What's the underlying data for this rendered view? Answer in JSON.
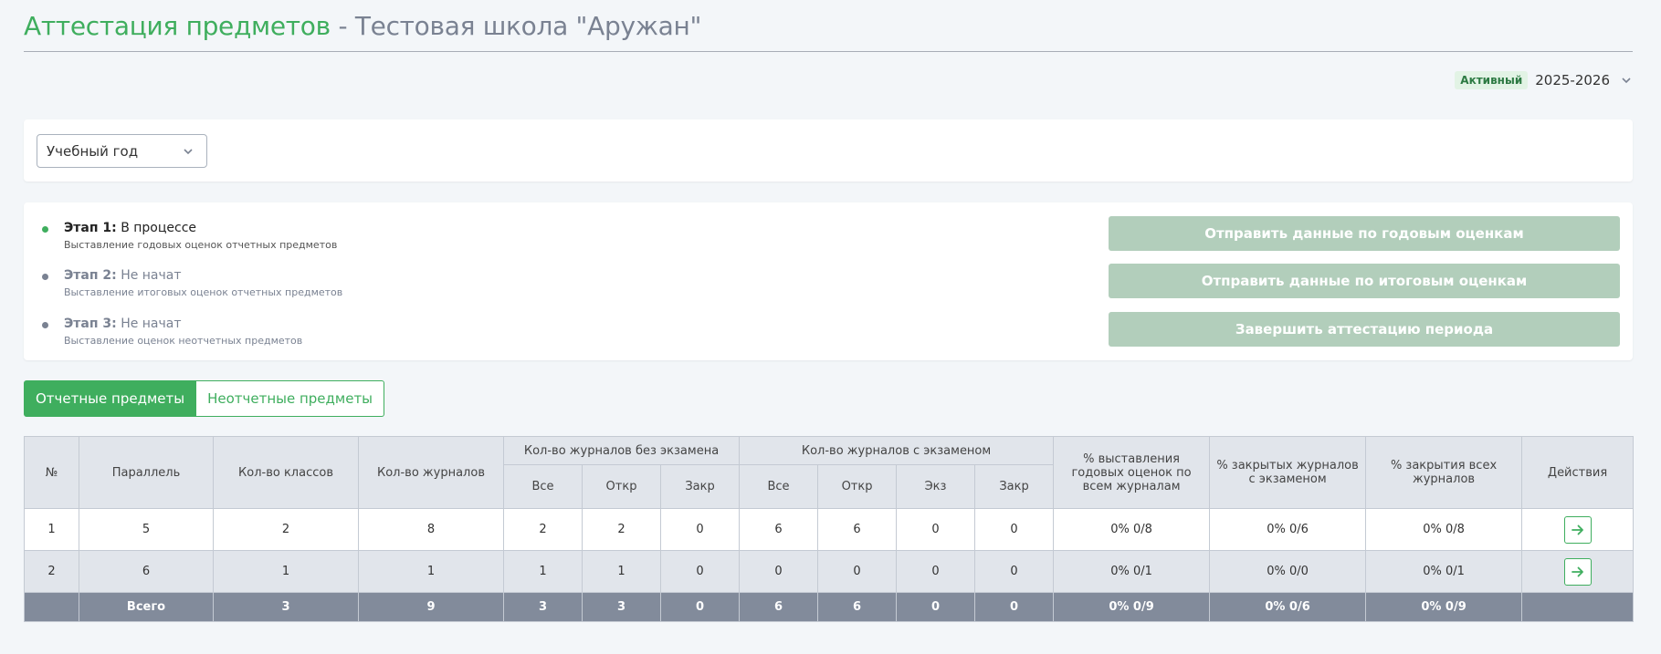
{
  "header": {
    "title_main": "Аттестация предметов",
    "title_sub": "- Тестовая школа \"Аружан\""
  },
  "year_picker": {
    "status_badge": "Активный",
    "value": "2025-2026",
    "icon": "chevron-down-icon"
  },
  "filter": {
    "year_select_value": "Учебный год",
    "icon": "chevron-down-icon"
  },
  "stages": [
    {
      "label": "Этап 1:",
      "status": "В процессе",
      "description": "Выставление годовых оценок отчетных предметов",
      "active": true,
      "dot_color": "#3fae5e"
    },
    {
      "label": "Этап 2:",
      "status": "Не начат",
      "description": "Выставление итоговых оценок отчетных предметов",
      "active": false,
      "dot_color": "#7a8292"
    },
    {
      "label": "Этап 3:",
      "status": "Не начат",
      "description": "Выставление оценок неотчетных предметов",
      "active": false,
      "dot_color": "#7a8292"
    }
  ],
  "actions": [
    {
      "label": "Отправить данные по годовым оценкам"
    },
    {
      "label": "Отправить данные по итоговым оценкам"
    },
    {
      "label": "Завершить аттестацию периода"
    }
  ],
  "tabs": [
    {
      "label": "Отчетные предметы",
      "active": true
    },
    {
      "label": "Неотчетные предметы",
      "active": false
    }
  ],
  "table": {
    "headers": {
      "num": "№",
      "parallel": "Параллель",
      "classes": "Кол-во классов",
      "journals": "Кол-во журналов",
      "no_exam_group": "Кол-во журналов без экзамена",
      "exam_group": "Кол-во журналов с экзаменом",
      "pct_annual": "% выставления годовых оценок по всем журналам",
      "pct_closed_exam": "% закрытых журналов с экзаменом",
      "pct_closed_all": "% закрытия всех журналов",
      "actions": "Действия",
      "no_exam_sub": [
        "Все",
        "Откр",
        "Закр"
      ],
      "exam_sub": [
        "Все",
        "Откр",
        "Экз",
        "Закр"
      ]
    },
    "rows": [
      {
        "num": "1",
        "parallel": "5",
        "classes": "2",
        "journals": "8",
        "ne_all": "2",
        "ne_open": "2",
        "ne_closed": "0",
        "e_all": "6",
        "e_open": "6",
        "e_exam": "0",
        "e_closed": "0",
        "pct_annual": "0% 0/8",
        "pct_closed_exam": "0% 0/6",
        "pct_closed_all": "0% 0/8",
        "action_icon": "arrow-right-icon"
      },
      {
        "num": "2",
        "parallel": "6",
        "classes": "1",
        "journals": "1",
        "ne_all": "1",
        "ne_open": "1",
        "ne_closed": "0",
        "e_all": "0",
        "e_open": "0",
        "e_exam": "0",
        "e_closed": "0",
        "pct_annual": "0% 0/1",
        "pct_closed_exam": "0% 0/0",
        "pct_closed_all": "0% 0/1",
        "action_icon": "arrow-right-icon"
      }
    ],
    "total": {
      "label": "Всего",
      "classes": "3",
      "journals": "9",
      "ne_all": "3",
      "ne_open": "3",
      "ne_closed": "0",
      "e_all": "6",
      "e_open": "6",
      "e_exam": "0",
      "e_closed": "0",
      "pct_annual": "0% 0/9",
      "pct_closed_exam": "0% 0/6",
      "pct_closed_all": "0% 0/9"
    }
  },
  "colors": {
    "brand_green": "#3fae5e",
    "disabled_button": "#b2cebb",
    "total_row": "#828b9b"
  }
}
